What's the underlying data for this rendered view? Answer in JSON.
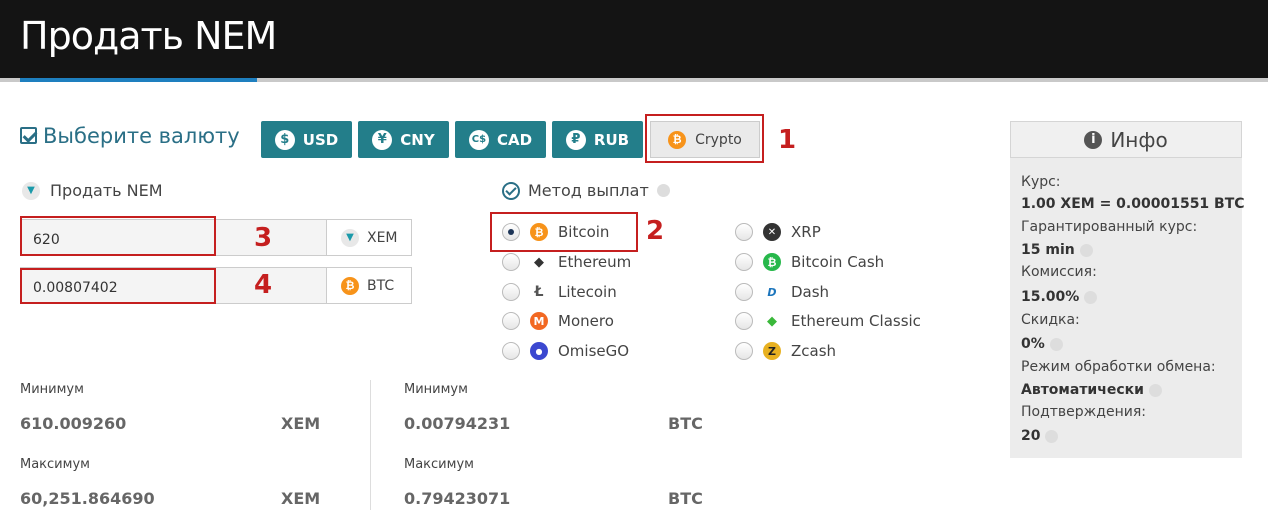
{
  "header": {
    "title": "Продать NEM"
  },
  "currency": {
    "label": "Выберите валюту",
    "buttons": [
      {
        "label": "USD",
        "icon": "$"
      },
      {
        "label": "CNY",
        "icon": "¥"
      },
      {
        "label": "CAD",
        "icon": "C$"
      },
      {
        "label": "RUB",
        "icon": "₽"
      },
      {
        "label": "Crypto",
        "icon": "₿"
      }
    ]
  },
  "sell": {
    "label": "Продать NEM",
    "amount_value": "620",
    "amount_unit": "XEM",
    "receive_value": "0.00807402",
    "receive_unit": "BTC"
  },
  "method": {
    "label": "Метод выплат",
    "options_left": [
      {
        "label": "Bitcoin",
        "selected": true,
        "color": "#f7931a",
        "glyph": "₿"
      },
      {
        "label": "Ethereum",
        "selected": false,
        "color": "#ffffff",
        "glyph": "◆"
      },
      {
        "label": "Litecoin",
        "selected": false,
        "color": "#ffffff",
        "glyph": "Ł"
      },
      {
        "label": "Monero",
        "selected": false,
        "color": "#f26822",
        "glyph": "M"
      },
      {
        "label": "OmiseGO",
        "selected": false,
        "color": "#3b48d0",
        "glyph": "●"
      }
    ],
    "options_right": [
      {
        "label": "XRP",
        "selected": false,
        "color": "#333333",
        "glyph": "✕"
      },
      {
        "label": "Bitcoin Cash",
        "selected": false,
        "color": "#27b84b",
        "glyph": "₿"
      },
      {
        "label": "Dash",
        "selected": false,
        "color": "#ffffff",
        "glyph": "D"
      },
      {
        "label": "Ethereum Classic",
        "selected": false,
        "color": "#ffffff",
        "glyph": "◆"
      },
      {
        "label": "Zcash",
        "selected": false,
        "color": "#e8b121",
        "glyph": "Z"
      }
    ]
  },
  "limits": {
    "left": {
      "min_label": "Минимум",
      "min_value": "610.009260",
      "min_unit": "XEM",
      "max_label": "Максимум",
      "max_value": "60,251.864690",
      "max_unit": "XEM"
    },
    "right": {
      "min_label": "Минимум",
      "min_value": "0.00794231",
      "min_unit": "BTC",
      "max_label": "Максимум",
      "max_value": "0.79423071",
      "max_unit": "BTC"
    }
  },
  "info": {
    "title": "Инфо",
    "rate_label": "Курс:",
    "rate_value": "1.00 XEM = 0.00001551 BTC",
    "guaranteed_label": "Гарантированный курс:",
    "guaranteed_value": "15 min",
    "fee_label": "Комиссия:",
    "fee_value": "15.00%",
    "discount_label": "Скидка:",
    "discount_value": "0%",
    "mode_label": "Режим обработки обмена:",
    "mode_value": "Автоматически",
    "confirm_label": "Подтверждения:",
    "confirm_value": "20"
  },
  "annotations": {
    "n1": "1",
    "n2": "2",
    "n3": "3",
    "n4": "4"
  },
  "colors": {
    "accent": "#237e8a",
    "annotation": "#c51f1f",
    "header": "#141414"
  }
}
